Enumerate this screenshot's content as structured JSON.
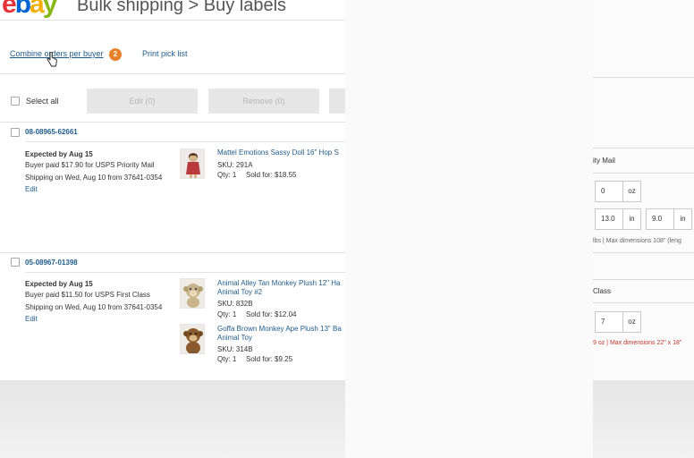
{
  "header": {
    "logo_letters": [
      "e",
      "b",
      "a",
      "y"
    ],
    "title": "Bulk shipping > Buy labels"
  },
  "toolbar": {
    "combine_label": "Combine orders per buyer",
    "combine_count": "2",
    "print_label": "Print pick list"
  },
  "actions": {
    "select_all": "Select all",
    "edit": "Edit (0)",
    "remove": "Remove (0)"
  },
  "orders": [
    {
      "number": "08-08965-62661",
      "expected": "Expected by Aug 15",
      "buyer_paid": "Buyer paid $17.90 for USPS Priority Mail",
      "shipping": "Shipping on Wed, Aug 10 from 37641-0354",
      "edit": "Edit",
      "items": [
        {
          "title": "Mattel Emotions Sassy Doll 16\" Hop S",
          "sku": "SKU: 291A",
          "qty": "Qty: 1",
          "sold_for": "Sold for: $18.55"
        }
      ]
    },
    {
      "number": "05-08967-01398",
      "expected": "Expected by Aug 15",
      "buyer_paid": "Buyer paid $11.50 for USPS First Class",
      "shipping": "Shipping on Wed, Aug 10 from 37641-0354",
      "edit": "Edit",
      "items": [
        {
          "title": "Animal Alley Tan Monkey Plush 12\" Ha Animal Toy #2",
          "sku": "SKU: 832B",
          "qty": "Qty: 1",
          "sold_for": "Sold for: $12.04"
        },
        {
          "title": "Goffa Brown Monkey Ape Plush 13\" Ba Animal Toy",
          "sku": "SKU: 314B",
          "qty": "Qty: 1",
          "sold_for": "Sold for: $9.25"
        }
      ]
    }
  ],
  "right_panel": {
    "service_1": "ity Mail",
    "weight_1": "0",
    "weight_1_unit": "oz",
    "dim_1_a": "13.0",
    "dim_1_a_unit": "in",
    "dim_1_b": "9.0",
    "dim_1_b_unit": "in",
    "note_1": "lbs | Max dimensions 108\" (leng",
    "service_2": "Class",
    "weight_2": "7",
    "weight_2_unit": "oz",
    "note_2": "9 oz | Max dimensions 22\" x 18\""
  },
  "colors": {
    "link": "#1f5b8a",
    "badge": "#e8822a",
    "warning": "#c0392b"
  }
}
